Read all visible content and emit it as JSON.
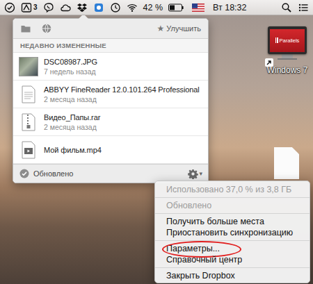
{
  "menubar": {
    "adobe_badge": "3",
    "battery": "42 %",
    "clock": "Вт 18:32"
  },
  "dropbox": {
    "upgrade_icon": "★",
    "upgrade": "Улучшить",
    "section": "НЕДАВНО ИЗМЕНЕННЫЕ",
    "files": [
      {
        "name": "DSC08987.JPG",
        "time": "7 недель назад",
        "kind": "photo"
      },
      {
        "name": "ABBYY FineReader 12.0.101.264 Professional",
        "time": "2 месяца назад",
        "kind": "document"
      },
      {
        "name": "Видео_Папы.rar",
        "time": "2 месяца назад",
        "kind": "archive"
      },
      {
        "name": "Мой фильм.mp4",
        "kind": "video"
      }
    ],
    "status": "Обновлено",
    "gear_arrow": "▾"
  },
  "desktop": {
    "icons": [
      {
        "kind": "app",
        "logo": "Parallels",
        "label": "Windows 7"
      },
      {
        "kind": "document"
      }
    ]
  },
  "menu": {
    "items": [
      {
        "kind": "item",
        "label": "Использовано 37,0 % из 3,8 ГБ",
        "disabled": true,
        "circled": false
      },
      {
        "kind": "separator"
      },
      {
        "kind": "item",
        "label": "Обновлено",
        "disabled": true,
        "circled": false
      },
      {
        "kind": "separator"
      },
      {
        "kind": "item",
        "label": "Получить больше места",
        "disabled": false,
        "circled": false
      },
      {
        "kind": "item",
        "label": "Приостановить синхронизацию",
        "disabled": false,
        "circled": false
      },
      {
        "kind": "separator"
      },
      {
        "kind": "item",
        "label": "Параметры...",
        "disabled": false,
        "circled": true
      },
      {
        "kind": "item",
        "label": "Справочный центр",
        "disabled": false,
        "circled": false
      },
      {
        "kind": "separator"
      },
      {
        "kind": "item",
        "label": "Закрыть Dropbox",
        "disabled": false,
        "circled": false
      }
    ]
  }
}
